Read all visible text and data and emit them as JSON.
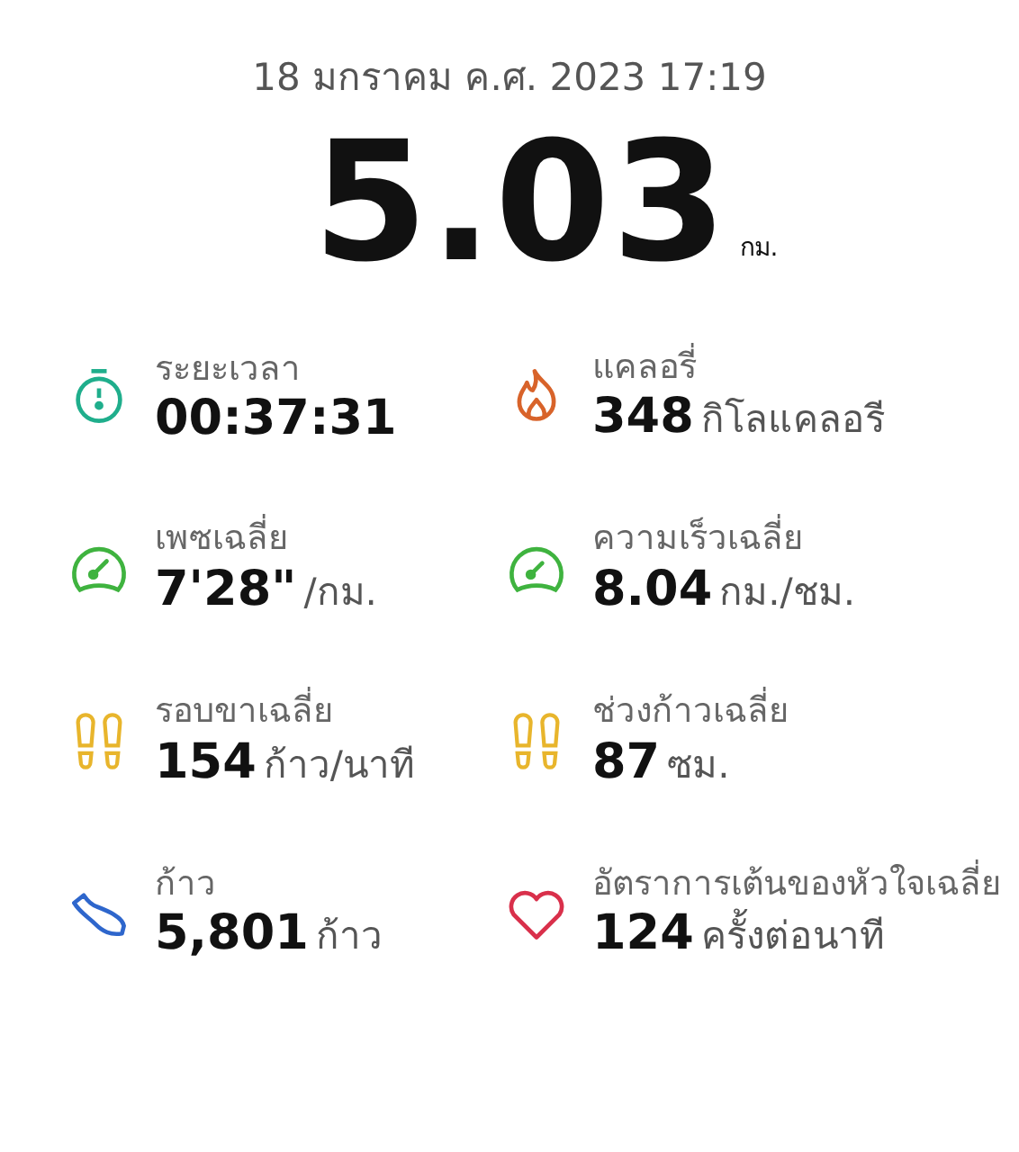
{
  "date": "18 มกราคม ค.ศ. 2023 17:19",
  "distance": {
    "value": "5.03",
    "unit": "กม."
  },
  "metrics": [
    {
      "kind": "stopwatch",
      "label": "ระยะเวลา",
      "value": "00:37:31"
    },
    {
      "kind": "flame",
      "label": "แคลอรี่",
      "value": "348",
      "unit": "กิโลแคลอรี"
    },
    {
      "kind": "gauge-left",
      "label": "เพซเฉลี่ย",
      "value": "7'28\"",
      "unit": "/กม."
    },
    {
      "kind": "gauge-right",
      "label": "ความเร็วเฉลี่ย",
      "value": "8.04",
      "unit": "กม./ชม."
    },
    {
      "kind": "footprints",
      "label": "รอบขาเฉลี่ย",
      "value": "154",
      "unit": "ก้าว/นาที"
    },
    {
      "kind": "footprints",
      "label": "ช่วงก้าวเฉลี่ย",
      "value": "87",
      "unit": "ซม."
    },
    {
      "kind": "shoe",
      "label": "ก้าว",
      "value": "5,801",
      "unit": "ก้าว"
    },
    {
      "kind": "heart",
      "label": "อัตราการเต้นของหัวใจเฉลี่ย",
      "value": "124",
      "unit": "ครั้งต่อนาที"
    }
  ]
}
